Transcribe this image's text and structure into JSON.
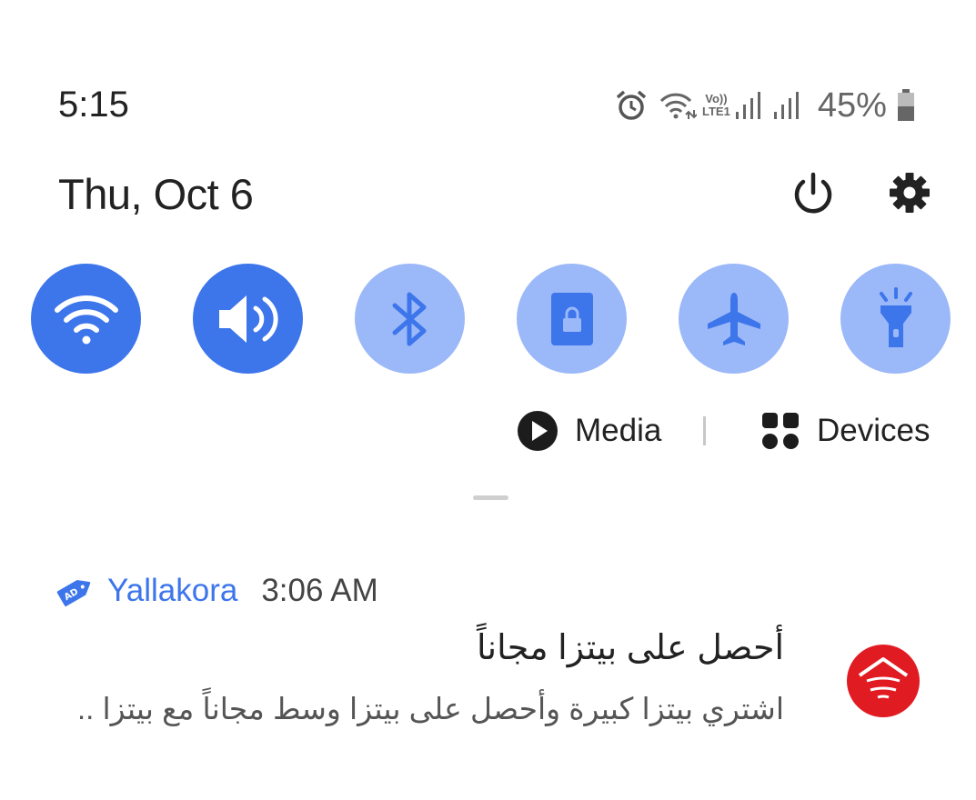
{
  "status_bar": {
    "time": "5:15",
    "network_label_top": "Vo))",
    "network_label_bottom": "LTE1",
    "battery_percent": "45%"
  },
  "header": {
    "date": "Thu, Oct 6"
  },
  "quick_tiles": [
    {
      "name": "wifi",
      "state": "on"
    },
    {
      "name": "sound",
      "state": "on"
    },
    {
      "name": "bluetooth",
      "state": "off"
    },
    {
      "name": "portrait-lock",
      "state": "off"
    },
    {
      "name": "airplane-mode",
      "state": "off"
    },
    {
      "name": "flashlight",
      "state": "off"
    }
  ],
  "media_bar": {
    "media_label": "Media",
    "devices_label": "Devices"
  },
  "notification": {
    "app_name": "Yallakora",
    "time": "3:06 AM",
    "title": "أحصل على بيتزا مجاناً",
    "body": "اشتري بيتزا كبيرة وأحصل على بيتزا وسط مجاناً مع بيتزا .."
  },
  "colors": {
    "tile_on": "#3d75eb",
    "tile_off": "#9bb8f8",
    "app_accent": "#3d75eb",
    "avatar_red": "#e11b22"
  }
}
